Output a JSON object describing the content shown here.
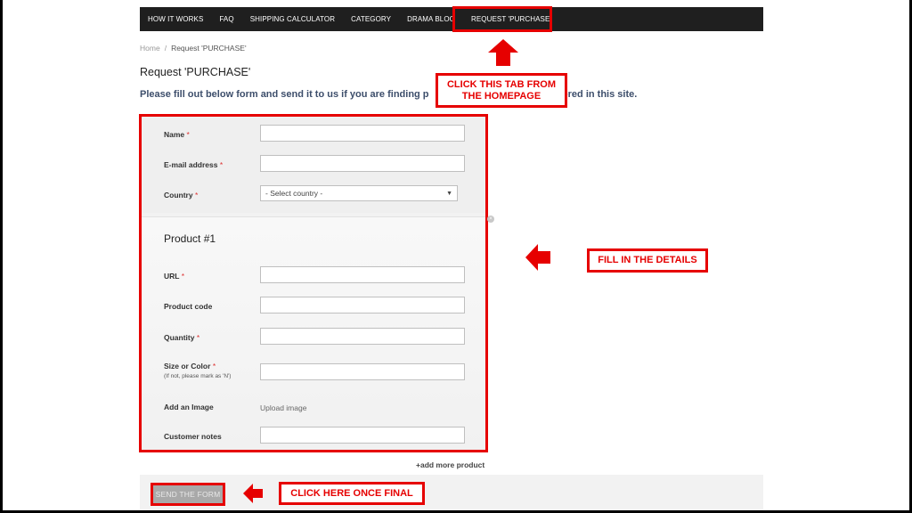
{
  "nav": {
    "items": [
      "HOW IT WORKS",
      "FAQ",
      "SHIPPING CALCULATOR",
      "CATEGORY",
      "DRAMA BLOG",
      "REQUEST 'PURCHASE'"
    ]
  },
  "breadcrumb": {
    "home": "Home",
    "separator": "/",
    "current": "Request 'PURCHASE'"
  },
  "page": {
    "title": "Request 'PURCHASE'",
    "intro_left": "Please fill out below form and send it to us if you are finding p",
    "intro_right": "ered in this site."
  },
  "form": {
    "name_label": "Name",
    "email_label": "E-mail address",
    "country_label": "Country",
    "country_selected": "- Select country -",
    "required_mark": "*",
    "product_heading": "Product #1",
    "url_label": "URL",
    "product_code_label": "Product code",
    "quantity_label": "Quantity",
    "size_color_label": "Size or Color",
    "size_color_note": "(If not, please mark as 'N')",
    "add_image_label": "Add an Image",
    "upload_image_link": "Upload image",
    "customer_notes_label": "Customer notes"
  },
  "add_more": "+add more product",
  "send_button": "SEND THE FORM",
  "callouts": {
    "tab": "CLICK THIS TAB FROM THE HOMEPAGE",
    "details": "FILL IN THE DETAILS",
    "final": "CLICK HERE ONCE FINAL"
  },
  "colors": {
    "highlight": "#e60000",
    "nav_bg": "#1f1f1f",
    "intro_text": "#3d4e6b"
  },
  "icons": {
    "select_arrow": "chevron-down-icon",
    "close": "close-icon"
  }
}
